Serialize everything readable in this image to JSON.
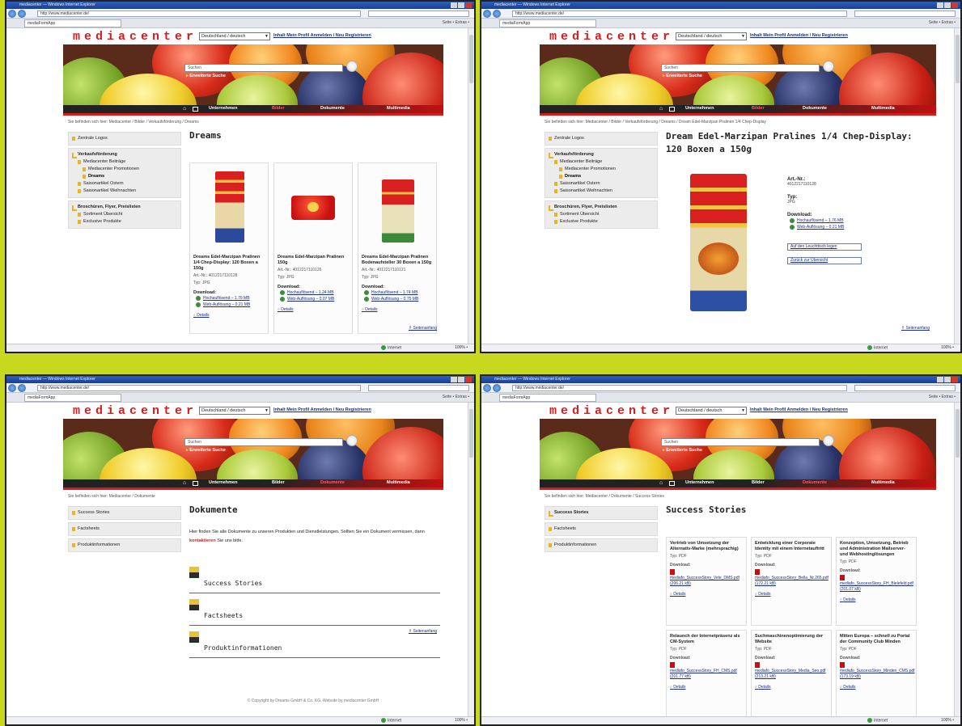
{
  "browser": {
    "title": "mediacenter — Windows Internet Explorer",
    "url": "http://www.mediacenter.de/",
    "tab": "mediaFormApp",
    "tools": "Seite • Extras •",
    "status_zone": "Internet",
    "status_zoom": "100% •"
  },
  "site": {
    "brand": "mediacenter",
    "language": "Deutschland / deutsch",
    "top_links": "Inhalt  Mein Profil  Anmelden / Neu Registrieren",
    "search_placeholder": "Suchen",
    "extended_search": "Erweiterte Suche",
    "menu": [
      "Unternehmen",
      "Bilder",
      "Dokumente",
      "Multimedia"
    ]
  },
  "panel1": {
    "crumbs": "Sie befinden sich hier: Mediacenter / Bilder / Verkaufsförderung / Dreams",
    "nav": {
      "box1": [
        "Zentrale Logos"
      ],
      "box2_open": "Verkaufsförderung",
      "box2_items": [
        "Mediacenter Beiträge",
        "Mediacenter Promotionen",
        "Dreams"
      ],
      "box2_more": [
        "Saisonartikel Ostern",
        "Saisonartikel Weihnachten"
      ],
      "box3_open": "Broschüren, Flyer, Preislisten",
      "box3_items": [
        "Sortiment Übersicht",
        "Exclusive Produkte"
      ]
    },
    "title": "Dreams",
    "products": [
      {
        "name": "Dreams Edel-Marzipan Pralinen 1/4 Chep-Display: 120 Boxen a 150g",
        "art": "Art.-Nr.: 4012217110128",
        "type": "Typ: JPG",
        "download": "Download:",
        "dl1": "Hochauflösend – 1.76 MB",
        "dl2": "Web-Auflösung – 0.21 MB",
        "details": "Details"
      },
      {
        "name": "Dreams Edel-Marzipan Pralinen 150g",
        "art": "Art.-Nr.: 4012217110126",
        "type": "Typ: JPG",
        "download": "Download:",
        "dl1": "Hochauflösend – 1.24 MB",
        "dl2": "Web-Auflösung – 0.07 MB",
        "details": "Details"
      },
      {
        "name": "Dreams Edel-Marzipan Pralinen Bodenaufsteller 30 Boxen a 150g",
        "art": "Art.-Nr.: 4012217110121",
        "type": "Typ: JPG",
        "download": "Download:",
        "dl1": "Hochauflösend – 1.74 MB",
        "dl2": "Web-Auflösung – 0.75 MB",
        "details": "Details"
      }
    ],
    "top": "⇑ Seitenanfang"
  },
  "panel2": {
    "crumbs": "Sie befinden sich hier: Mediacenter / Bilder / Verkaufsförderung / Dreams / Dream Edel-Marzipan Pralinen 1/4 Chep-Display",
    "title": "Dream Edel-Marzipan Pralines 1/4 Chep-Display: 120 Boxen a 150g",
    "art_label": "Art.-Nr.:",
    "art_value": "4012217110128",
    "type_label": "Typ:",
    "type_value": "JPG",
    "download_label": "Download:",
    "dl1": "Hochauflösend – 1.76 MB",
    "dl2": "Web-Auflösung – 0.21 MB",
    "btn_cart": "Auf den Leuchttisch legen",
    "btn_back": "Zurück zur Übersicht",
    "top": "⇑ Seitenanfang"
  },
  "panel3": {
    "crumbs": "Sie befinden sich hier: Mediacenter / Dokumente",
    "nav": [
      "Success Stories",
      "Factsheets",
      "Produktinformationen"
    ],
    "title": "Dokumente",
    "intro_a": "Hier finden Sie alle Dokumente zu unseren Produkten und Dienstleistungen. Sollten Sie ein Dokument vermissen, dann",
    "intro_link": "kontaktieren",
    "intro_b": "Sie uns bitte.",
    "docs": [
      "Success Stories",
      "Factsheets",
      "Produktinformationen"
    ],
    "top": "⇑ Seitenanfang",
    "footer": "© Copyright by Dreams GmbH & Co. KG. Website by mediacenter GmbH"
  },
  "panel4": {
    "crumbs": "Sie befinden sich hier: Mediacenter / Dokumente / Success Stories",
    "nav": [
      "Success Stories",
      "Factsheets",
      "Produktinformationen"
    ],
    "title": "Success Stories",
    "cards": [
      {
        "title": "Vertrieb von Umsetzung der Alternativ-Marke (mehrsprachig)",
        "type": "Typ: PDF",
        "download": "Download:",
        "link": "mediafo_SuccessStory_Vele_DMS.pdf (206.21 kB)",
        "details": "Details"
      },
      {
        "title": "Entwicklung einer Corporate Identity mit einem Internetauftritt",
        "type": "Typ: PDF",
        "download": "Download:",
        "link": "mediafo_SuccessStory_Bella_Nr.265.pdf (172.21 kB)",
        "details": "Details"
      },
      {
        "title": "Konzeption, Umsetzung, Betrieb und Administration Mailserver- und Webhostinglösungen",
        "type": "Typ: PDF",
        "download": "Download:",
        "link": "mediafo_SuccessStory_FH_Bielefeld.pdf (201.07 kB)",
        "details": "Details"
      },
      {
        "title": "Relaunch der Internetpräsenz als CM-System",
        "type": "Typ: PDF",
        "download": "Download:",
        "link": "mediafo_SuccessStory_FH_CMS.pdf (201.77 kB)",
        "details": "Details"
      },
      {
        "title": "Suchmaschinenoptimierung der Website",
        "type": "Typ: PDF",
        "download": "Download:",
        "link": "mediafo_SuccessStory_Media_Seo.pdf (213.21 kB)",
        "details": "Details"
      },
      {
        "title": "Mitten Europa – schnell zu Portal der Community Club Minden",
        "type": "Typ: PDF",
        "download": "Download:",
        "link": "mediafo_SuccessStory_Minden_CMS.pdf (173.19 kB)",
        "details": "Details"
      }
    ]
  }
}
